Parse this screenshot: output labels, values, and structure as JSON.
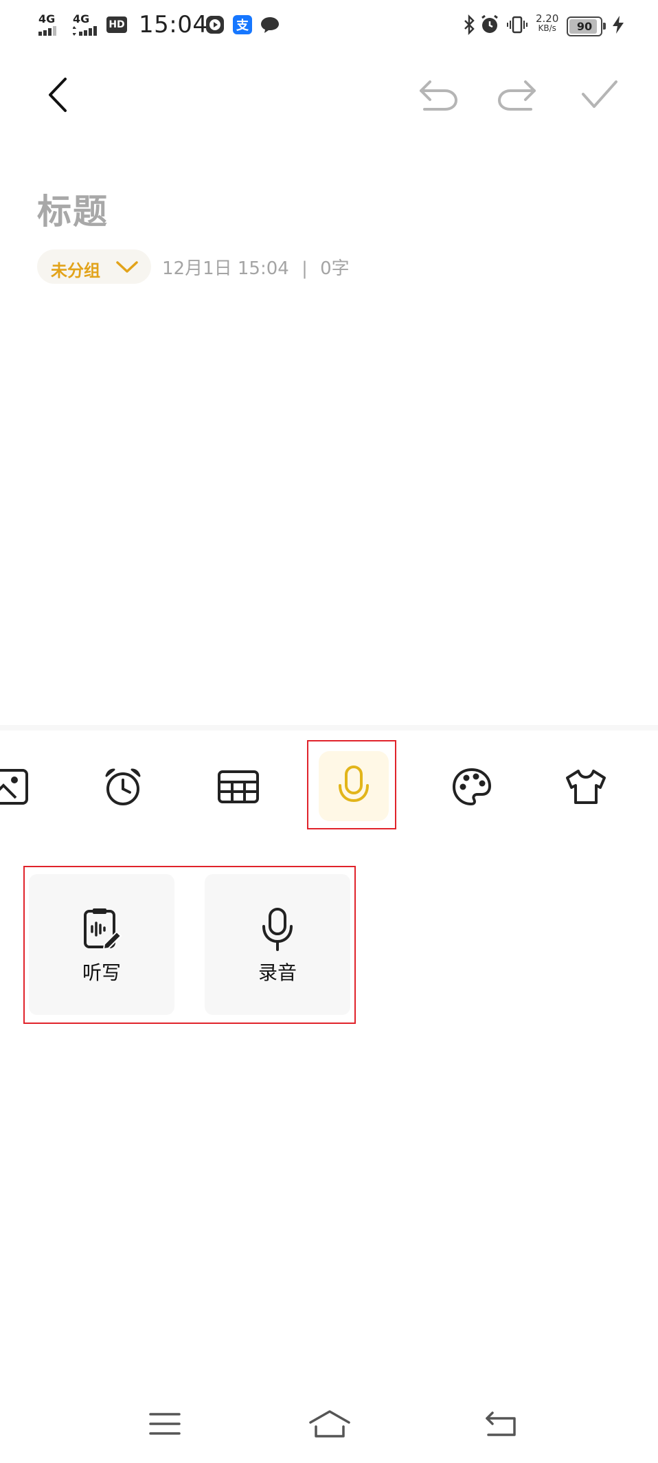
{
  "status_bar": {
    "signal_1": "4G",
    "signal_2": "4G",
    "hd_label": "HD",
    "time": "15:04",
    "net_speed_value": "2.20",
    "net_speed_unit": "KB/s",
    "battery_level": "90",
    "icons": [
      "video-app-icon",
      "alipay-icon",
      "chat-bubble-icon",
      "bluetooth-icon",
      "alarm-icon",
      "vibrate-icon",
      "charging-bolt-icon"
    ]
  },
  "toolbar": {
    "back": "back-chevron-icon",
    "undo": "undo-icon",
    "redo": "redo-icon",
    "confirm": "check-icon"
  },
  "note": {
    "title_placeholder": "标题",
    "group_label": "未分组",
    "datetime": "12月1日 15:04",
    "separator": "|",
    "word_count": "0字"
  },
  "tools": [
    {
      "name": "image-icon",
      "active": false
    },
    {
      "name": "alarm-clock-icon",
      "active": false
    },
    {
      "name": "table-icon",
      "active": false
    },
    {
      "name": "microphone-icon",
      "active": true
    },
    {
      "name": "palette-icon",
      "active": false
    },
    {
      "name": "tshirt-icon",
      "active": false
    }
  ],
  "audio_options": [
    {
      "label": "听写",
      "icon": "dictation-icon"
    },
    {
      "label": "录音",
      "icon": "microphone-icon"
    }
  ],
  "colors": {
    "accent": "#e2a31a",
    "accent_bg": "#fff8e6",
    "highlight_box": "#e0222a",
    "placeholder_text": "#a8a8a8"
  },
  "system_nav": [
    "menu-icon",
    "home-icon",
    "back-icon"
  ]
}
